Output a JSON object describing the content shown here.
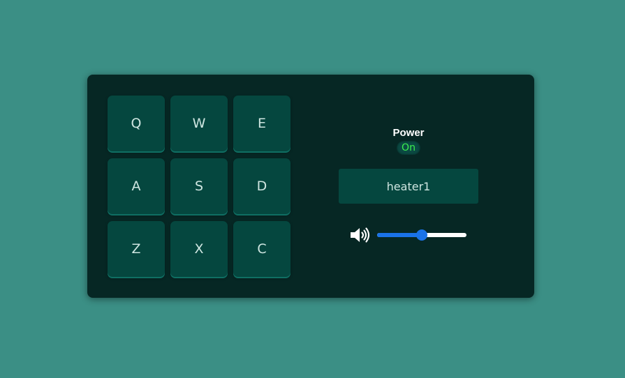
{
  "pads": [
    {
      "key": "Q"
    },
    {
      "key": "W"
    },
    {
      "key": "E"
    },
    {
      "key": "A"
    },
    {
      "key": "S"
    },
    {
      "key": "D"
    },
    {
      "key": "Z"
    },
    {
      "key": "X"
    },
    {
      "key": "C"
    }
  ],
  "power": {
    "label": "Power",
    "state": "On"
  },
  "display": {
    "text": "heater1"
  },
  "volume": {
    "icon": "volume-up-icon",
    "level": 0.5
  },
  "colors": {
    "background": "#3b8f85",
    "panel": "#062724",
    "pad": "#05473f",
    "power_on": "#3cf04e",
    "slider_accent": "#1a73e8"
  }
}
